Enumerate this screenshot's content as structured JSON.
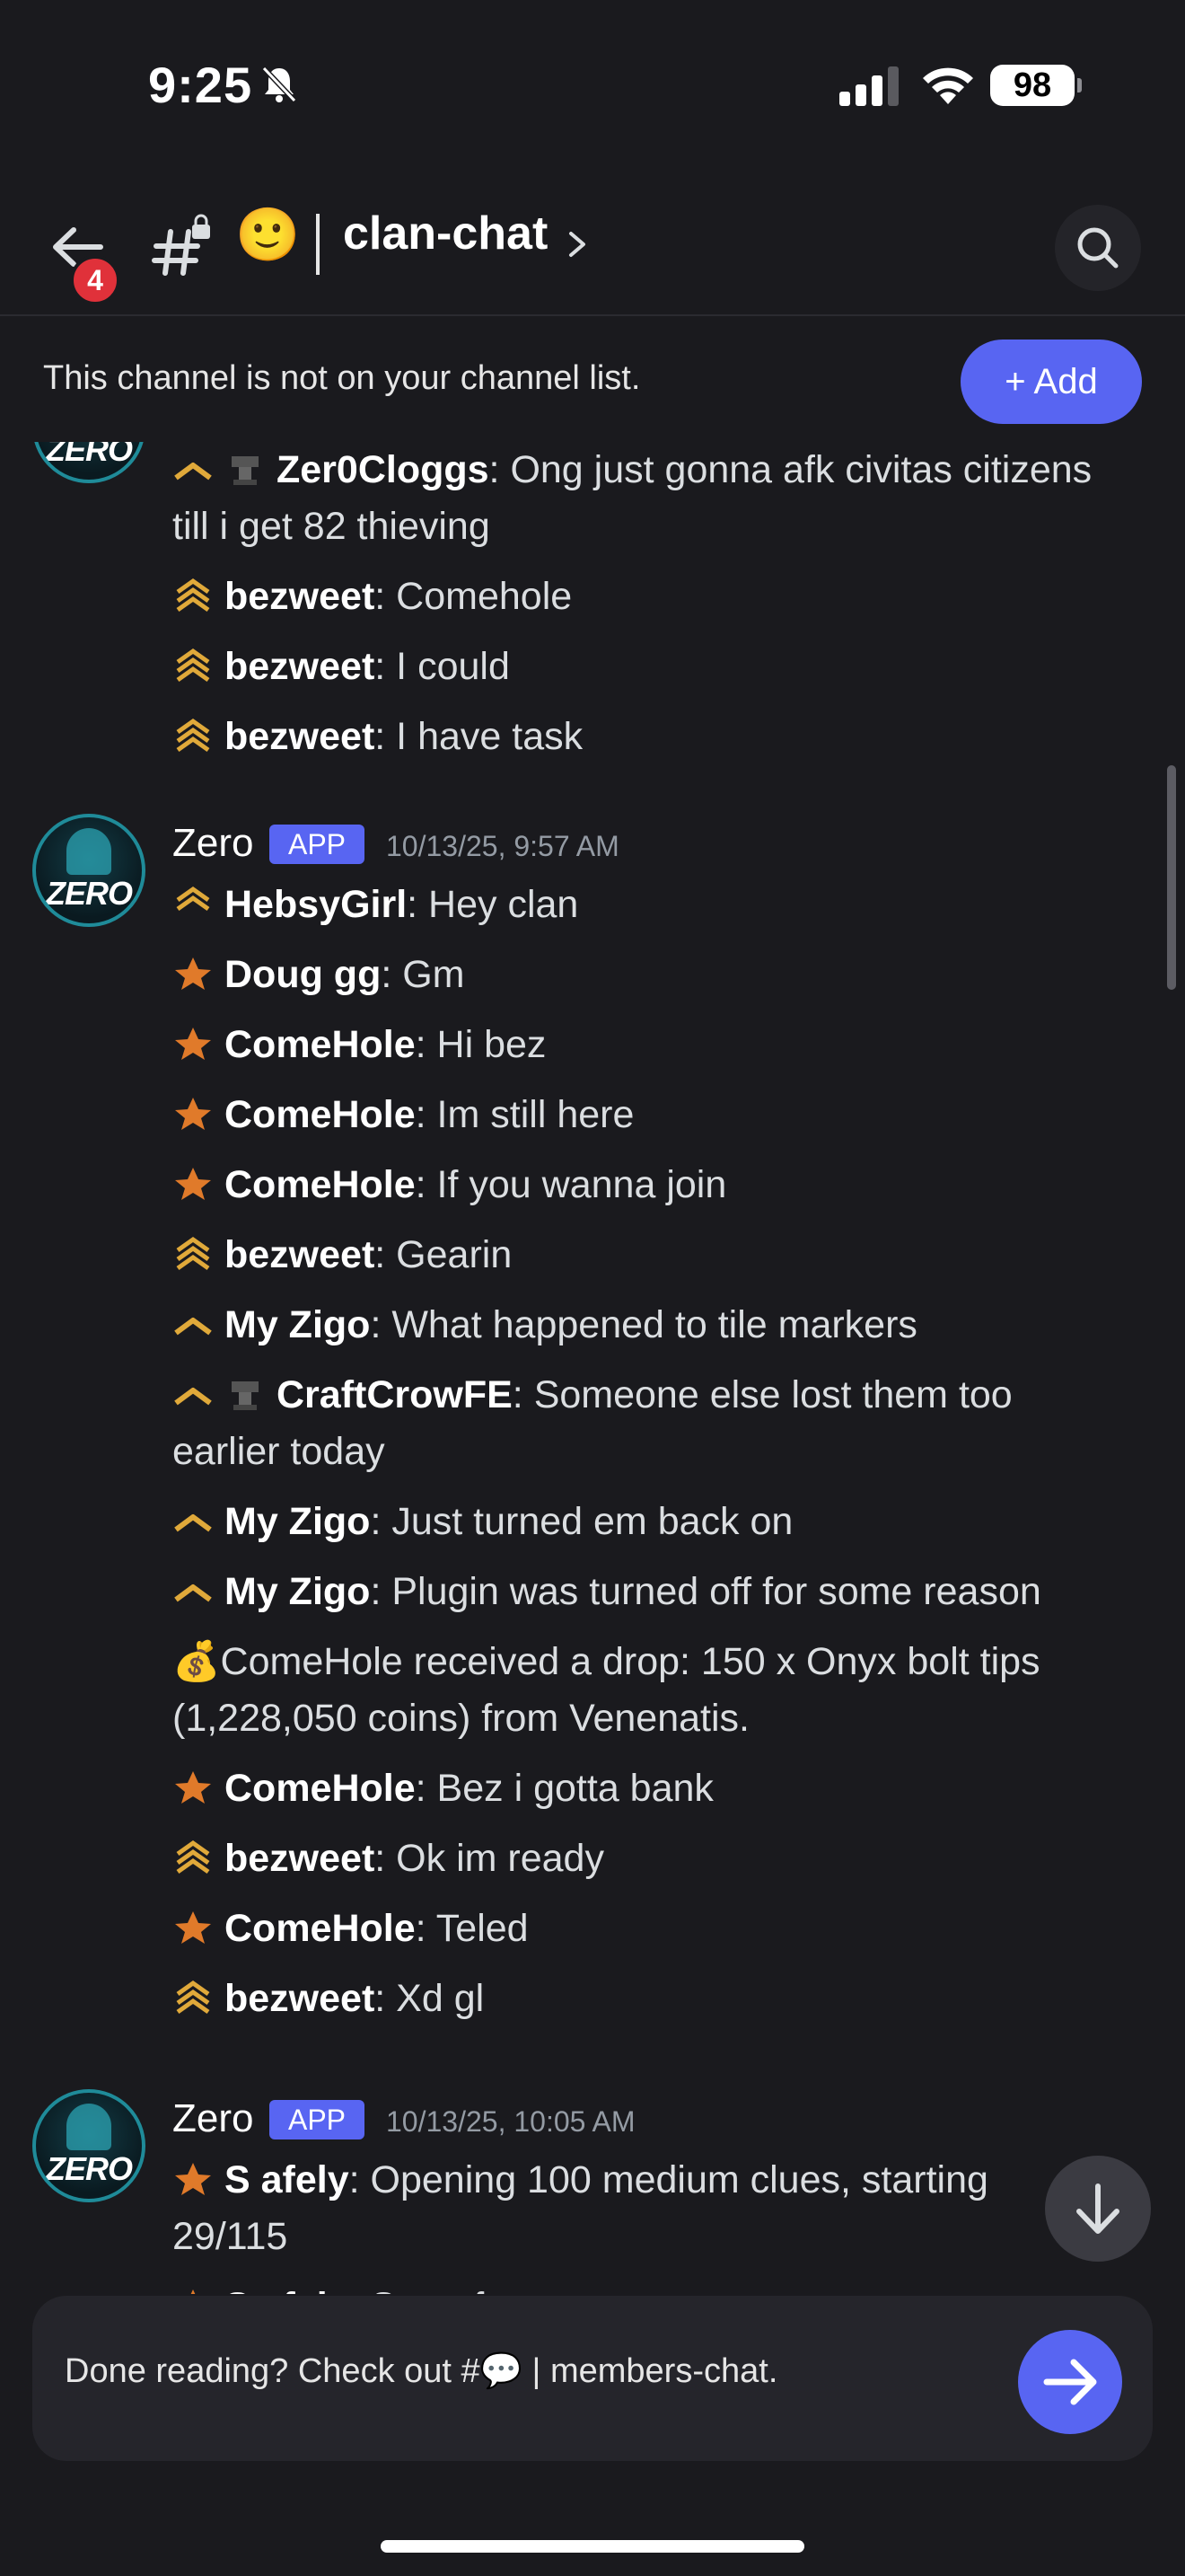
{
  "status": {
    "time": "9:25",
    "battery": "98"
  },
  "header": {
    "notif_count": "4",
    "channel_emoji": "🙂",
    "channel_name": "clan-chat"
  },
  "banner": {
    "text": "This channel is not on your channel list.",
    "add_label": "+ Add"
  },
  "messages": {
    "top_lines": [
      {
        "user": "Zer0Cloggs",
        "text": ": Ong just gonna afk civitas citizens",
        "cont": "till i get 82 thieving"
      },
      {
        "user": "bezweet",
        "text": ": Comehole"
      },
      {
        "user": "bezweet",
        "text": ": I could"
      },
      {
        "user": "bezweet",
        "text": ": I have task"
      }
    ],
    "group1": {
      "author": "Zero",
      "tag": "APP",
      "timestamp": "10/13/25, 9:57 AM",
      "lines": [
        {
          "user": "HebsyGirl",
          "text": ": Hey clan"
        },
        {
          "user": "Doug gg",
          "text": ": Gm"
        },
        {
          "user": "ComeHole",
          "text": ": Hi bez"
        },
        {
          "user": "ComeHole",
          "text": ": Im still here"
        },
        {
          "user": "ComeHole",
          "text": ": If you wanna join"
        },
        {
          "user": "bezweet",
          "text": ": Gearin"
        },
        {
          "user": "My Zigo",
          "text": ": What happened to tile markers"
        },
        {
          "user": "CraftCrowFE",
          "text": ": Someone else lost them too",
          "cont": "earlier today"
        },
        {
          "user": "My Zigo",
          "text": ": Just turned em back on"
        },
        {
          "user": "My Zigo",
          "text": ": Plugin was turned off for some reason"
        },
        {
          "drop": "💰ComeHole received a drop: 150 x Onyx bolt tips",
          "cont": "(1,228,050 coins) from Venenatis."
        },
        {
          "user": "ComeHole",
          "text": ": Bez i gotta bank"
        },
        {
          "user": "bezweet",
          "text": ": Ok im ready"
        },
        {
          "user": "ComeHole",
          "text": ": Teled"
        },
        {
          "user": "bezweet",
          "text": ": Xd gl"
        }
      ]
    },
    "group2": {
      "author": "Zero",
      "tag": "APP",
      "timestamp": "10/13/25, 10:05 AM",
      "lines": [
        {
          "user": "S afely",
          "text": ": Opening 100 medium clues, starting",
          "cont": "29/115"
        },
        {
          "user": "S afely",
          "text": ": Sorry for spam"
        }
      ]
    },
    "avatar_text": "ZERO"
  },
  "prompt": {
    "pre": "Done reading? Check out #",
    "emoji": "💬",
    "post": " | members-chat."
  },
  "colors": {
    "accent": "#5865f2",
    "badge": "#e0313a",
    "background": "#1a1a1e"
  }
}
